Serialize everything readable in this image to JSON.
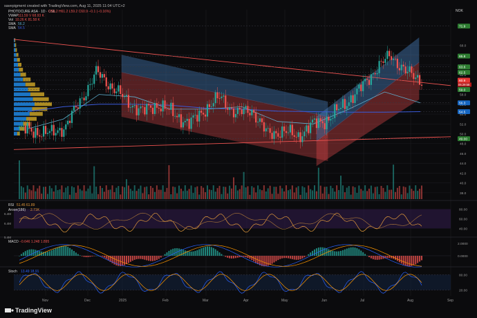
{
  "header": {
    "caption": "savepigment created with TradingView.com, Aug 11, 2025 11:04 UTC+2",
    "symbol_line": "PHOTOCURE ASA · 1D · OSL",
    "ohlc": "O59.2 H61.2 L59.2 C60.9 −0.1 (−0.16%)",
    "vwap_label": "VWAP",
    "vwap_values": "111.59 V   68.93 K",
    "vol_label": "Vol",
    "vol_values": "10.26 K   81.58 K",
    "sma1_label": "SMA",
    "sma1_value": "56.2",
    "sma2_label": "SMA",
    "sma2_value": "54.5",
    "currency": "NOK"
  },
  "price_axis": {
    "ticks": [
      "68.0",
      "66.0",
      "64.0",
      "62.0",
      "60.0",
      "58.0",
      "56.0",
      "54.0",
      "52.0",
      "50.0",
      "48.0",
      "46.0",
      "44.0",
      "42.0",
      "40.0",
      "38.0"
    ],
    "tag_71": "71.9",
    "tag_65": "65.8",
    "tag_63": "63.6",
    "tag_62": "62.5",
    "tag_current": "60.9",
    "tag_countdown": "05:29:58",
    "tag_59": "59.0",
    "tag_56": "56.3",
    "tag_54": "54.5",
    "tag_49": "49.00"
  },
  "rsi_panel": {
    "label": "RSI",
    "values": "51.45   61.89",
    "sublabel": "Aroon(186)",
    "sub_values": "2.71K",
    "ticks": [
      "80.00",
      "60.00",
      "40.00"
    ],
    "left_ticks": [
      "6.4M",
      "6.4M"
    ]
  },
  "macd_panel": {
    "label": "MACD",
    "values": "−0.646   1.248   1.895",
    "ticks": [
      "2.0000",
      "0.0000"
    ],
    "left_tick": "5.4M"
  },
  "stoch_panel": {
    "label": "Stoch",
    "values": "13.49   18.91",
    "ticks": [
      "80.00",
      "20.00"
    ]
  },
  "time_axis": [
    "Nov",
    "Dec",
    "2025",
    "Feb",
    "Mar",
    "Apr",
    "May",
    "Jun",
    "Jul",
    "Aug",
    "Sep"
  ],
  "watermark": "TradingView",
  "colors": {
    "up": "#26a69a",
    "down": "#ef5350",
    "channel_blue": "#4f8fd6",
    "channel_red": "#e0484a",
    "sma_blue": "#3b5bdb",
    "sma_teal": "#5fb0d0",
    "rsi_line": "#e39a3c",
    "rsi_bg": "#2a1840",
    "macd_line": "#2962ff",
    "signal_line": "#ff9800",
    "stoch_k": "#2962ff",
    "stoch_d": "#ff9800"
  },
  "chart_data": {
    "type": "candlestick",
    "period": "daily",
    "x_range": [
      "Oct 2024",
      "Sep 2025"
    ],
    "price_range": [
      37,
      72
    ],
    "month_labels": [
      "Nov",
      "Dec",
      "2025",
      "Feb",
      "Mar",
      "Apr",
      "May",
      "Jun",
      "Jul",
      "Aug",
      "Sep"
    ],
    "close_path": [
      {
        "t": "Oct",
        "y": 51.0
      },
      {
        "t": "Nov",
        "y": 50.5
      },
      {
        "t": "Nov",
        "y": 50.0
      },
      {
        "t": "Dec",
        "y": 51.5
      },
      {
        "t": "Dec",
        "y": 57.0
      },
      {
        "t": "Dec",
        "y": 62.5
      },
      {
        "t": "2025",
        "y": 59.5
      },
      {
        "t": "2025",
        "y": 56.5
      },
      {
        "t": "Feb",
        "y": 54.5
      },
      {
        "t": "Feb",
        "y": 56.0
      },
      {
        "t": "Mar",
        "y": 54.0
      },
      {
        "t": "Mar",
        "y": 52.0
      },
      {
        "t": "Apr",
        "y": 55.0
      },
      {
        "t": "Apr",
        "y": 57.5
      },
      {
        "t": "Apr",
        "y": 54.0
      },
      {
        "t": "May",
        "y": 55.0
      },
      {
        "t": "May",
        "y": 50.0
      },
      {
        "t": "May",
        "y": 50.5
      },
      {
        "t": "Jun",
        "y": 49.5
      },
      {
        "t": "Jun",
        "y": 52.0
      },
      {
        "t": "Jul",
        "y": 53.0
      },
      {
        "t": "Jul",
        "y": 56.0
      },
      {
        "t": "Jul",
        "y": 59.0
      },
      {
        "t": "Jul",
        "y": 63.0
      },
      {
        "t": "Aug",
        "y": 66.0
      },
      {
        "t": "Aug",
        "y": 62.5
      },
      {
        "t": "Aug",
        "y": 60.9
      }
    ],
    "levels": [
      71.9,
      65.8,
      63.6,
      62.5,
      60.9,
      59.0,
      56.3,
      54.5,
      49.0
    ],
    "sma_long_path": [
      54.5,
      55.5,
      56.0,
      56.0,
      55.8,
      55.2,
      55.0,
      54.6,
      54.5,
      54.4,
      54.4,
      54.5
    ],
    "sma_short_path": [
      51.0,
      53.0,
      58.0,
      57.5,
      55.0,
      55.0,
      55.5,
      52.5,
      52.0,
      55.0,
      58.5,
      56.3
    ]
  }
}
